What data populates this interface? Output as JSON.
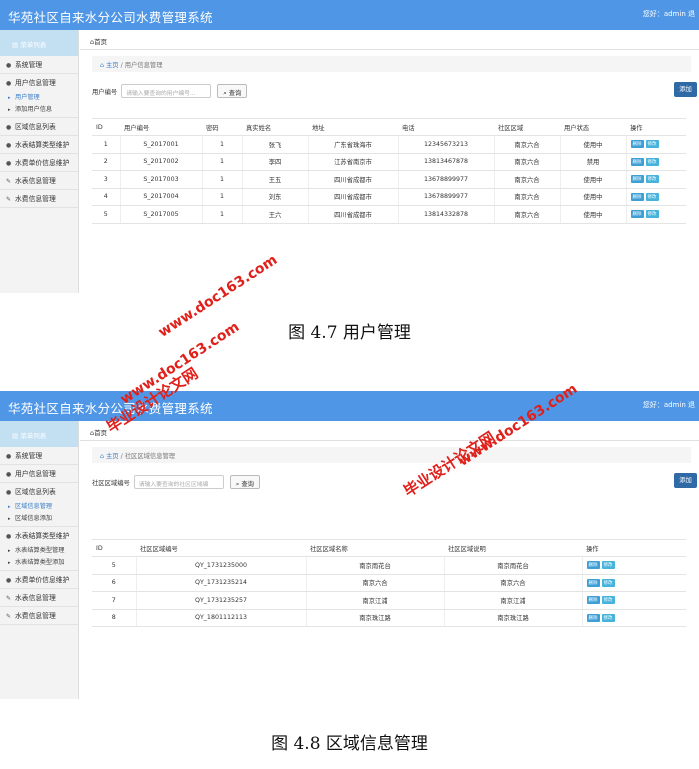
{
  "app_title": "华苑社区自来水分公司水费管理系统",
  "greeting": "您好：admin 退",
  "nav_heading": "菜单列表",
  "home_link": "首页",
  "search_button": "查询",
  "add_button": "添加",
  "op_delete": "删除",
  "op_edit": "修改",
  "shot1": {
    "nav": {
      "item_system": "系统管理",
      "item_user": "用户信息管理",
      "sub_user_manage": "用户管理",
      "sub_user_add": "添加用户信息",
      "item_region": "区域信息列表",
      "item_settle": "水表结算类型维护",
      "item_price": "水费单价信息维护",
      "item_meter": "水表信息管理",
      "item_water": "水费信息管理"
    },
    "crumb_home": "主页",
    "crumb_current": "用户信息管理",
    "search_label": "用户编号",
    "search_placeholder": "请输入要查询的用户编号...",
    "headers": [
      "ID",
      "用户编号",
      "密码",
      "真实姓名",
      "地址",
      "电话",
      "社区区域",
      "用户状态",
      "操作"
    ],
    "rows": [
      [
        "1",
        "S_2017001",
        "1",
        "张飞",
        "广东省珠海市",
        "12345673213",
        "南京六合",
        "使用中"
      ],
      [
        "2",
        "S_2017002",
        "1",
        "李四",
        "江苏省南京市",
        "13813467878",
        "南京六合",
        "禁用"
      ],
      [
        "3",
        "S_2017003",
        "1",
        "王五",
        "四川省成都市",
        "13678899977",
        "南京六合",
        "使用中"
      ],
      [
        "4",
        "S_2017004",
        "1",
        "刘东",
        "四川省成都市",
        "13678899977",
        "南京六合",
        "使用中"
      ],
      [
        "5",
        "S_2017005",
        "1",
        "王六",
        "四川省成都市",
        "13814332878",
        "南京六合",
        "使用中"
      ]
    ]
  },
  "caption1": "图 4.7  用户管理",
  "shot2": {
    "nav": {
      "item_system": "系统管理",
      "item_user": "用户信息管理",
      "item_region": "区域信息列表",
      "sub_region_manage": "区域信息管理",
      "sub_region_add": "区域信息添加",
      "item_settle": "水表结算类型维护",
      "sub_settle_manage": "水表结算类型管理",
      "sub_settle_add": "水表结算类型添加",
      "item_price": "水费单价信息维护",
      "item_meter": "水表信息管理",
      "item_water": "水费信息管理"
    },
    "crumb_home": "主页",
    "crumb_current": "社区区域信息管理",
    "search_label": "社区区域编号",
    "search_placeholder": "请输入要查询的社区区域编",
    "headers": [
      "ID",
      "社区区域编号",
      "社区区域名称",
      "社区区域说明",
      "操作"
    ],
    "rows": [
      [
        "5",
        "QY_1731235000",
        "南京雨花台",
        "南京雨花台"
      ],
      [
        "6",
        "QY_1731235214",
        "南京六合",
        "南京六合"
      ],
      [
        "7",
        "QY_1731235257",
        "南京江浦",
        "南京江浦"
      ],
      [
        "8",
        "QY_1801112113",
        "南京珠江路",
        "南京珠江路"
      ]
    ]
  },
  "caption2": "图 4.8  区域信息管理",
  "watermark_site": "www.doc163.com",
  "watermark_name": "毕业设计论文网"
}
